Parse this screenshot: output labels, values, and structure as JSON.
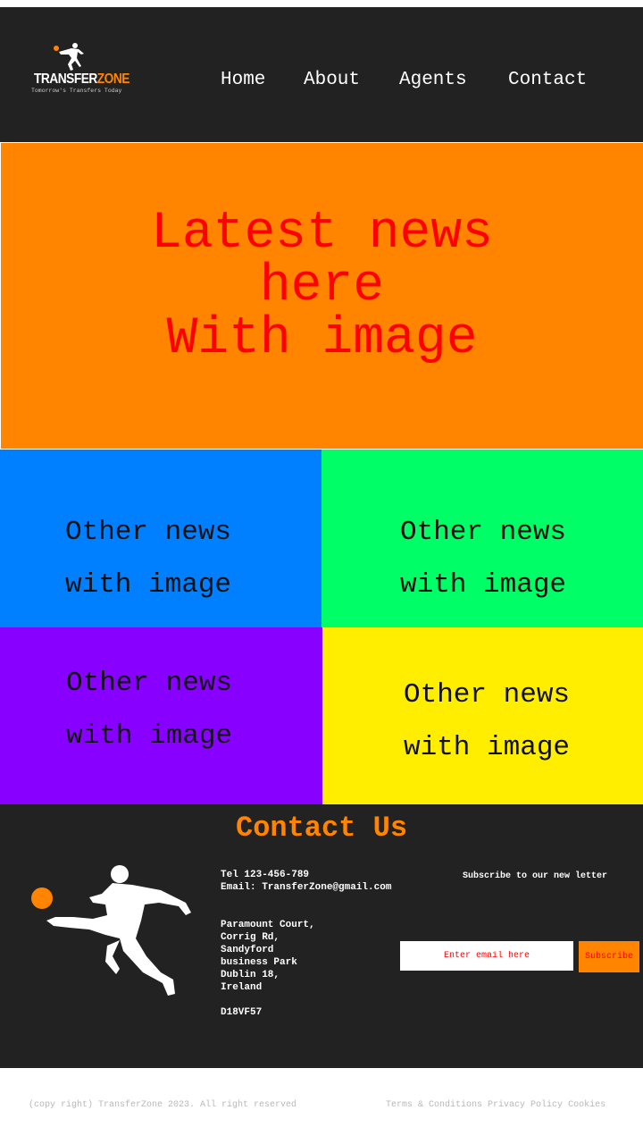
{
  "brand": {
    "name_main": "TRANSFER",
    "name_accent": "ZONE",
    "tagline": "Tomorrow's Transfers Today",
    "accent_color": "#ff8500"
  },
  "nav": {
    "items": [
      {
        "label": "Home"
      },
      {
        "label": "About"
      },
      {
        "label": "Agents"
      },
      {
        "label": "Contact"
      }
    ]
  },
  "hero": {
    "lines": [
      "Latest news",
      "here",
      "With image"
    ],
    "background": "#ff8500",
    "text_color": "#ff0000"
  },
  "tiles": [
    {
      "line1": "Other news",
      "line2": "with image",
      "background": "#0080ff"
    },
    {
      "line1": "Other news",
      "line2": "with image",
      "background": "#00ff66"
    },
    {
      "line1": "Other news",
      "line2": "with image",
      "background": "#8800ff"
    },
    {
      "line1": "Other news",
      "line2": "with image",
      "background": "#ffee00"
    }
  ],
  "contact": {
    "title": "Contact Us",
    "tel": "Tel 123-456-789",
    "email": "Email: TransferZone@gmail.com",
    "address": [
      "Paramount Court,",
      "Corrig Rd,",
      "Sandyford",
      "business Park",
      "Dublin 18,",
      "Ireland"
    ],
    "postcode": "D18VF57",
    "icon": "footballer-silhouette-icon"
  },
  "newsletter": {
    "heading": "Subscribe to our new letter",
    "placeholder": "Enter email here",
    "button_label": "Subscribe"
  },
  "footer": {
    "copyright": "(copy right) TransferZone 2023. All right reserved",
    "links": [
      "Terms & Conditions",
      "Privacy Policy",
      "Cookies"
    ]
  }
}
